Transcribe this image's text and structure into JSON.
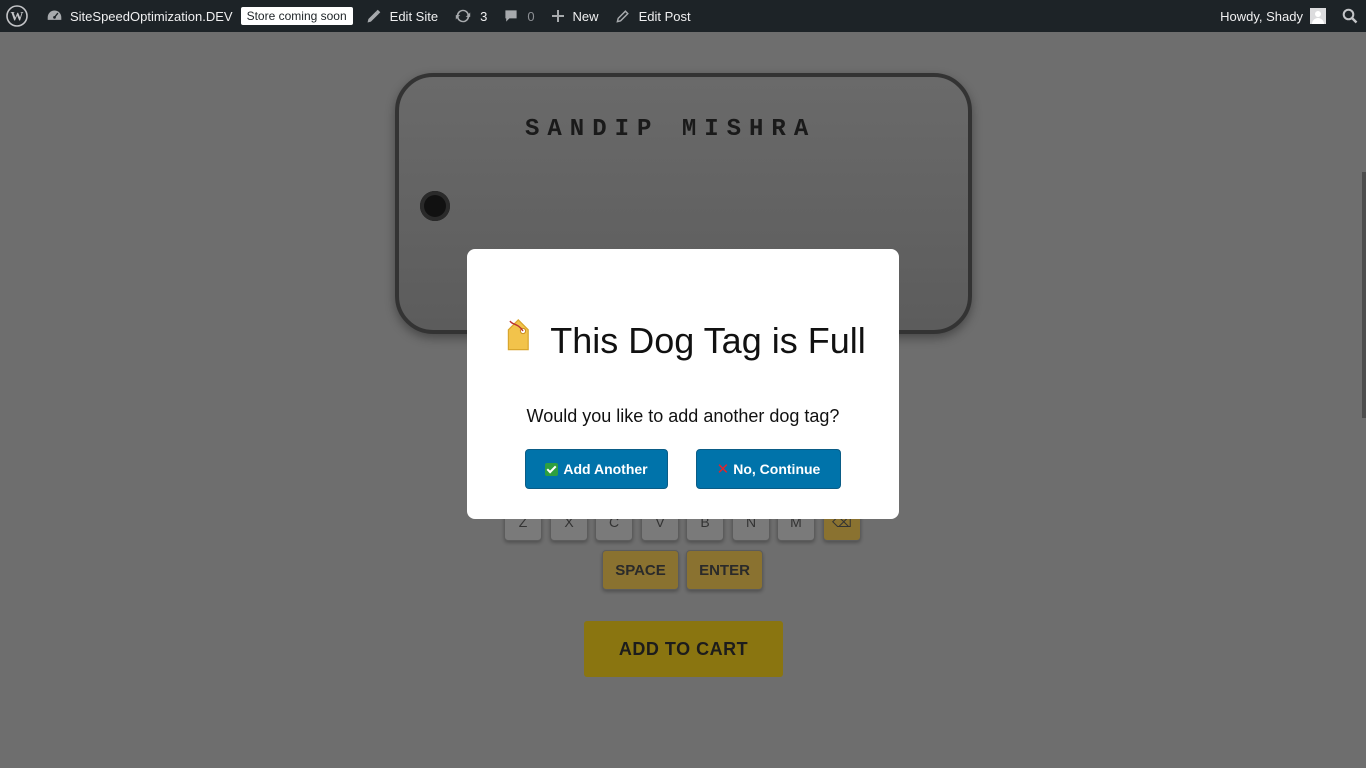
{
  "adminbar": {
    "site_name": "SiteSpeedOptimization.DEV",
    "badge": "Store coming soon",
    "edit_site": "Edit Site",
    "updates_count": "3",
    "comments_count": "0",
    "new_label": "New",
    "edit_post": "Edit Post",
    "greeting": "Howdy, Shady"
  },
  "dogtag": {
    "line1": "SANDIP MISHRA"
  },
  "keyboard": {
    "row3": [
      "Z",
      "X",
      "C",
      "V",
      "B",
      "N",
      "M"
    ],
    "backspace": "⌫",
    "space": "SPACE",
    "enter": "ENTER"
  },
  "cart": {
    "label": "ADD TO CART"
  },
  "modal": {
    "title_emoji": "🏷️",
    "title": "This Dog Tag is Full",
    "subtitle": "Would you like to add another dog tag?",
    "add_another": "Add Another",
    "no_continue": "No, Continue",
    "x_glyph": "✕"
  }
}
